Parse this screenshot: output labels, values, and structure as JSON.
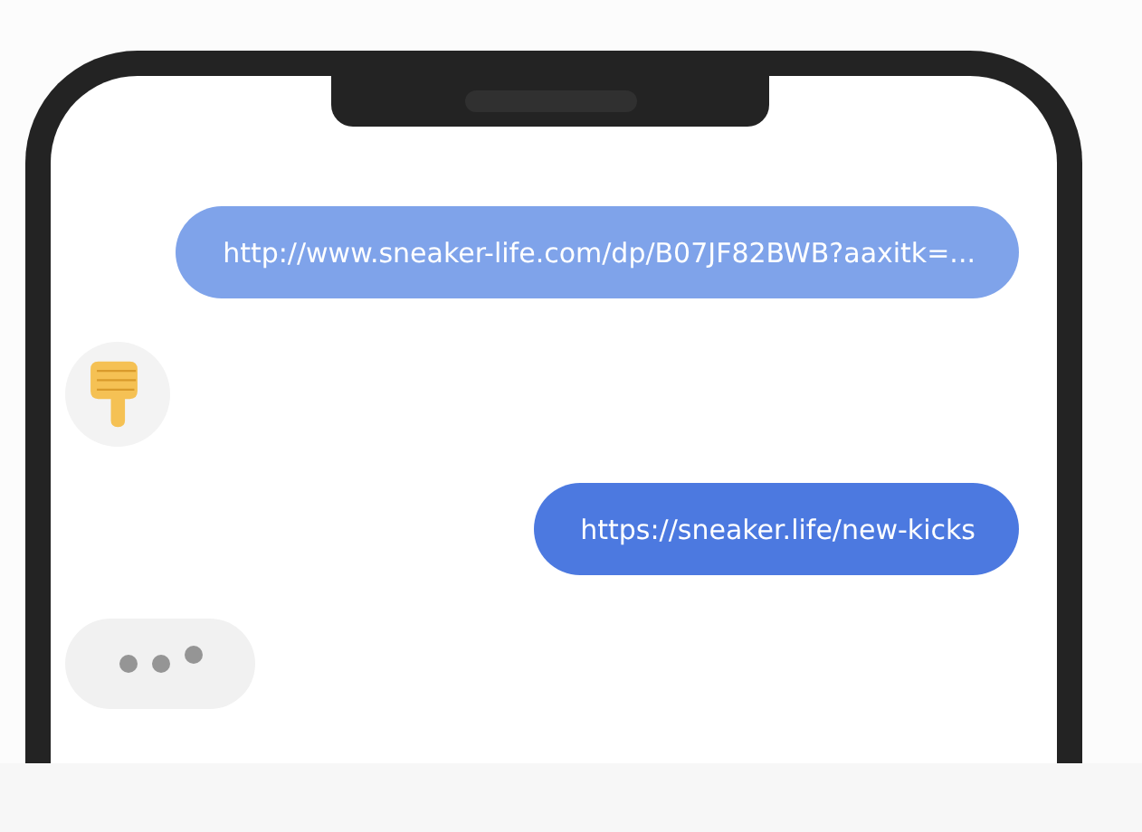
{
  "messages": [
    {
      "kind": "sent",
      "text": "http://www.sneaker-life.com/dp/B07JF82BWB?aaxitk=...",
      "color": "#7fa3ea"
    },
    {
      "kind": "reaction"
    },
    {
      "kind": "sent",
      "text": "https://sneaker.life/new-kicks",
      "color": "#4c79e0"
    },
    {
      "kind": "typing"
    }
  ]
}
